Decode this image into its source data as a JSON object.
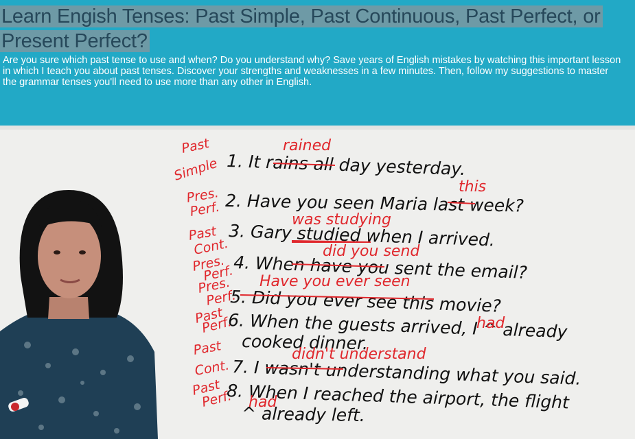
{
  "video": {
    "title": "Learn Engish Tenses: Past Simple, Past Continuous, Past Perfect, or Present Perfect?",
    "description": "Are you sure which past tense to use and when? Do you understand why? Save years of English mistakes by watching this important lesson in which I teach you about past tenses. Discover your strengths and weaknesses in a few minutes. Then, follow my suggestions to master the grammar tenses you'll need to use more than any other in English."
  },
  "board": {
    "sentences": [
      {
        "text": "1. It rains all day yesterday.",
        "correction": "rained",
        "label": [
          "Past",
          "Simple"
        ]
      },
      {
        "text": "2. Have you seen Maria last week?",
        "correction": "this",
        "label": [
          "Pres.",
          "Perf."
        ]
      },
      {
        "text": "3. Gary studied when I arrived.",
        "correction": "was studying",
        "label": [
          "Past",
          "Cont."
        ]
      },
      {
        "text": "4. When have you sent the email?",
        "correction": "did you send",
        "label": [
          "Pres.",
          "Perf."
        ]
      },
      {
        "text": "5. Did you ever see this movie?",
        "correction": "Have you ever seen",
        "label": [
          "Pres.",
          "Perf."
        ]
      },
      {
        "text": "6. When the guests arrived, I ^ already",
        "correction": "had",
        "label": [
          "Past",
          "Perf."
        ]
      },
      {
        "text": "cooked dinner.",
        "correction": "",
        "label": []
      },
      {
        "text": "7. I wasn't understanding what you said.",
        "correction": "didn't understand",
        "label": [
          "Past",
          "Cont."
        ]
      },
      {
        "text": "8. When I reached the airport, the flight",
        "correction": "",
        "label": [
          "Past",
          "Perf."
        ]
      },
      {
        "text": "^ already left.",
        "correction": "had",
        "label": []
      }
    ]
  },
  "colors": {
    "header_bg": "#22a9c6",
    "title_text": "#26485a",
    "title_highlight": "#6e9aa6",
    "ink_black": "#111111",
    "ink_red": "#e0282d"
  }
}
